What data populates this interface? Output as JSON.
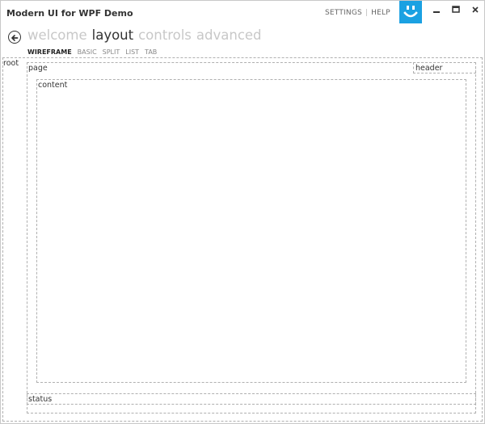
{
  "window": {
    "title": "Modern UI for WPF Demo",
    "settings_label": "SETTINGS",
    "separator": "|",
    "help_label": "HELP",
    "accent_color": "#1ba1e2",
    "logo_icon": "smiley-logo-icon"
  },
  "menu": {
    "items": [
      {
        "label": "welcome",
        "active": false
      },
      {
        "label": "layout",
        "active": true
      },
      {
        "label": "controls",
        "active": false
      },
      {
        "label": "advanced",
        "active": false
      }
    ]
  },
  "submenu": {
    "items": [
      {
        "label": "WIREFRAME",
        "active": true
      },
      {
        "label": "BASIC",
        "active": false
      },
      {
        "label": "SPLIT",
        "active": false
      },
      {
        "label": "LIST",
        "active": false
      },
      {
        "label": "TAB",
        "active": false
      }
    ]
  },
  "wireframe": {
    "root_label": "root",
    "page_label": "page",
    "header_label": "header",
    "content_label": "content",
    "status_label": "status"
  }
}
